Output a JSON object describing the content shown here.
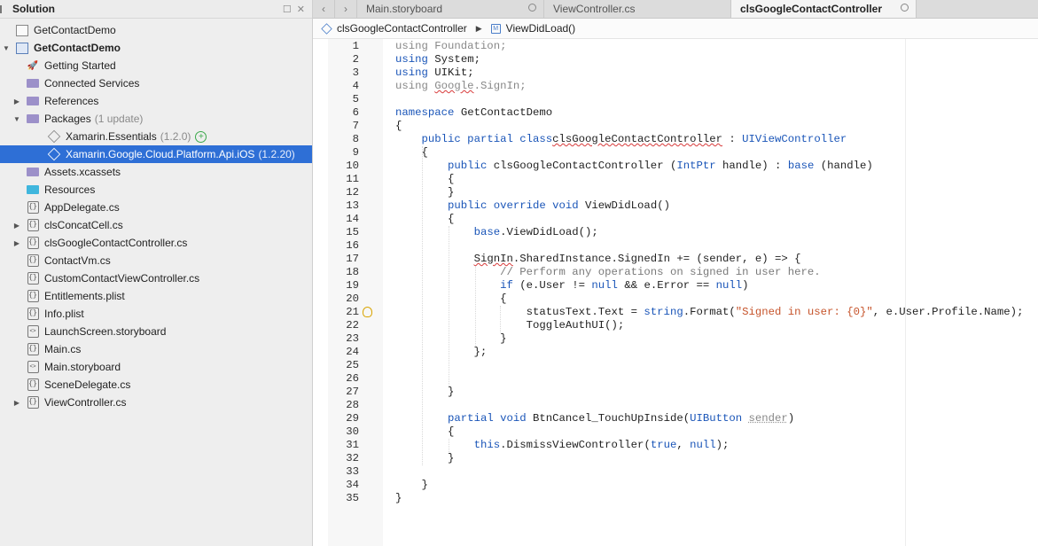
{
  "solution": {
    "title": "Solution",
    "header_icons": [
      "minimize-icon",
      "close-icon"
    ],
    "items": [
      {
        "label": "GetContactDemo",
        "icon": "solution-icon",
        "arrow": "",
        "indent": 0,
        "bold": false
      },
      {
        "label": "GetContactDemo",
        "icon": "project-icon",
        "arrow": "▼",
        "indent": 0,
        "bold": true
      },
      {
        "label": "Getting Started",
        "icon": "rocket-icon",
        "arrow": "",
        "indent": 1
      },
      {
        "label": "Connected Services",
        "icon": "services-folder-icon",
        "arrow": "",
        "indent": 1
      },
      {
        "label": "References",
        "icon": "references-folder-icon",
        "arrow": "▶",
        "indent": 1
      },
      {
        "label": "Packages",
        "note": "(1 update)",
        "icon": "packages-folder-icon",
        "arrow": "▼",
        "indent": 1
      },
      {
        "label": "Xamarin.Essentials",
        "note": "(1.2.0)",
        "icon": "package-icon",
        "arrow": "",
        "indent": 2,
        "update": true
      },
      {
        "label": "Xamarin.Google.Cloud.Platform.Api.iOS",
        "note": "(1.2.20)",
        "icon": "package-icon",
        "arrow": "",
        "indent": 2,
        "selected": true
      },
      {
        "label": "Assets.xcassets",
        "icon": "assets-folder-icon",
        "arrow": "",
        "indent": 1
      },
      {
        "label": "Resources",
        "icon": "folder-icon",
        "arrow": "",
        "indent": 1
      },
      {
        "label": "AppDelegate.cs",
        "icon": "cs-file-icon",
        "arrow": "",
        "indent": 1
      },
      {
        "label": "clsConcatCell.cs",
        "icon": "cs-file-icon",
        "arrow": "▶",
        "indent": 1
      },
      {
        "label": "clsGoogleContactController.cs",
        "icon": "cs-file-icon",
        "arrow": "▶",
        "indent": 1
      },
      {
        "label": "ContactVm.cs",
        "icon": "cs-file-icon",
        "arrow": "",
        "indent": 1
      },
      {
        "label": "CustomContactViewController.cs",
        "icon": "cs-file-icon",
        "arrow": "",
        "indent": 1
      },
      {
        "label": "Entitlements.plist",
        "icon": "cs-file-icon",
        "arrow": "",
        "indent": 1
      },
      {
        "label": "Info.plist",
        "icon": "cs-file-icon",
        "arrow": "",
        "indent": 1
      },
      {
        "label": "LaunchScreen.storyboard",
        "icon": "storyboard-file-icon",
        "arrow": "",
        "indent": 1
      },
      {
        "label": "Main.cs",
        "icon": "cs-file-icon",
        "arrow": "",
        "indent": 1
      },
      {
        "label": "Main.storyboard",
        "icon": "storyboard-file-icon",
        "arrow": "",
        "indent": 1
      },
      {
        "label": "SceneDelegate.cs",
        "icon": "cs-file-icon",
        "arrow": "",
        "indent": 1
      },
      {
        "label": "ViewController.cs",
        "icon": "cs-file-icon",
        "arrow": "▶",
        "indent": 1
      }
    ]
  },
  "tabs": [
    {
      "label": "Main.storyboard",
      "active": false
    },
    {
      "label": "ViewController.cs",
      "active": false
    },
    {
      "label": "clsGoogleContactController",
      "active": true
    }
  ],
  "pathbar": {
    "class_name": "clsGoogleContactController",
    "method_name": "ViewDidLoad()"
  },
  "code": {
    "lines": [
      {
        "n": "1",
        "segs": [
          [
            "dim",
            "using Foundation;"
          ]
        ]
      },
      {
        "n": "2",
        "segs": [
          [
            "kw",
            "using"
          ],
          [
            "",
            "System;"
          ]
        ]
      },
      {
        "n": "3",
        "segs": [
          [
            "kw",
            "using"
          ],
          [
            "",
            "UIKit;"
          ]
        ]
      },
      {
        "n": "4",
        "segs": [
          [
            "dim",
            "using "
          ],
          [
            "squigdim",
            "Google"
          ],
          [
            "dim",
            ".SignIn;"
          ]
        ]
      },
      {
        "n": "5",
        "segs": []
      },
      {
        "n": "6",
        "segs": [
          [
            "kw",
            "namespace"
          ],
          [
            "",
            "GetContactDemo"
          ]
        ]
      },
      {
        "n": "7",
        "segs": [
          [
            "",
            "{"
          ]
        ]
      },
      {
        "n": "8",
        "segs": [
          [
            "",
            "    "
          ],
          [
            "kw",
            "public partial class"
          ],
          [
            "",
            ""
          ],
          [
            "squig",
            "clsGoogleContactController"
          ],
          [
            "",
            " : "
          ],
          [
            "ty",
            "UIViewController"
          ]
        ]
      },
      {
        "n": "9",
        "segs": [
          [
            "",
            "    {"
          ]
        ]
      },
      {
        "n": "10",
        "segs": [
          [
            "",
            "        "
          ],
          [
            "kw",
            "public"
          ],
          [
            "",
            " clsGoogleContactController ("
          ],
          [
            "ty",
            "IntPtr"
          ],
          [
            "",
            " handle) : "
          ],
          [
            "kw",
            "base"
          ],
          [
            "",
            " (handle)"
          ]
        ]
      },
      {
        "n": "11",
        "segs": [
          [
            "",
            "        {"
          ]
        ]
      },
      {
        "n": "12",
        "segs": [
          [
            "",
            "        }"
          ]
        ]
      },
      {
        "n": "13",
        "segs": [
          [
            "",
            "        "
          ],
          [
            "kw",
            "public override void"
          ],
          [
            "",
            " ViewDidLoad()"
          ]
        ]
      },
      {
        "n": "14",
        "segs": [
          [
            "",
            "        {"
          ]
        ]
      },
      {
        "n": "15",
        "segs": [
          [
            "",
            "            "
          ],
          [
            "kw",
            "base"
          ],
          [
            "",
            ".ViewDidLoad();"
          ]
        ]
      },
      {
        "n": "16",
        "segs": []
      },
      {
        "n": "17",
        "segs": [
          [
            "",
            "            "
          ],
          [
            "squig",
            "SignIn"
          ],
          [
            "",
            ".SharedInstance.SignedIn += (sender, e) => {"
          ]
        ]
      },
      {
        "n": "18",
        "segs": [
          [
            "",
            "                "
          ],
          [
            "cm",
            "// Perform any operations on signed in user here."
          ]
        ]
      },
      {
        "n": "19",
        "segs": [
          [
            "",
            "                "
          ],
          [
            "kw",
            "if"
          ],
          [
            "",
            " (e.User != "
          ],
          [
            "kw",
            "null"
          ],
          [
            "",
            " && e.Error == "
          ],
          [
            "kw",
            "null"
          ],
          [
            "",
            ")"
          ]
        ]
      },
      {
        "n": "20",
        "segs": [
          [
            "",
            "                {"
          ]
        ]
      },
      {
        "n": "21",
        "segs": [
          [
            "",
            "                    statusText.Text = "
          ],
          [
            "kw",
            "string"
          ],
          [
            "",
            ".Format("
          ],
          [
            "str",
            "\"Signed in user: {0}\""
          ],
          [
            "",
            ", e.User.Profile.Name);"
          ]
        ],
        "bulb": true
      },
      {
        "n": "22",
        "segs": [
          [
            "",
            "                    ToggleAuthUI();"
          ]
        ]
      },
      {
        "n": "23",
        "segs": [
          [
            "",
            "                }"
          ]
        ]
      },
      {
        "n": "24",
        "segs": [
          [
            "",
            "            };"
          ]
        ]
      },
      {
        "n": "25",
        "segs": []
      },
      {
        "n": "26",
        "segs": []
      },
      {
        "n": "27",
        "segs": [
          [
            "",
            "        }"
          ]
        ]
      },
      {
        "n": "28",
        "segs": []
      },
      {
        "n": "29",
        "segs": [
          [
            "",
            "        "
          ],
          [
            "kw",
            "partial void"
          ],
          [
            "",
            " BtnCancel_TouchUpInside("
          ],
          [
            "ty",
            "UIButton"
          ],
          [
            "",
            " "
          ],
          [
            "dotted",
            "sender"
          ],
          [
            "",
            ")"
          ]
        ]
      },
      {
        "n": "30",
        "segs": [
          [
            "",
            "        {"
          ]
        ]
      },
      {
        "n": "31",
        "segs": [
          [
            "",
            "            "
          ],
          [
            "kw",
            "this"
          ],
          [
            "",
            ".DismissViewController("
          ],
          [
            "kw",
            "true"
          ],
          [
            "",
            ", "
          ],
          [
            "kw",
            "null"
          ],
          [
            "",
            ");"
          ]
        ]
      },
      {
        "n": "32",
        "segs": [
          [
            "",
            "        }"
          ]
        ]
      },
      {
        "n": "33",
        "segs": []
      },
      {
        "n": "34",
        "segs": [
          [
            "",
            "    }"
          ]
        ]
      },
      {
        "n": "35",
        "segs": [
          [
            "",
            "}"
          ]
        ]
      }
    ]
  },
  "colors": {
    "selection": "#2e6fd6",
    "keyword": "#1a55b8",
    "string": "#c6532a",
    "comment": "#7a7a7a"
  }
}
